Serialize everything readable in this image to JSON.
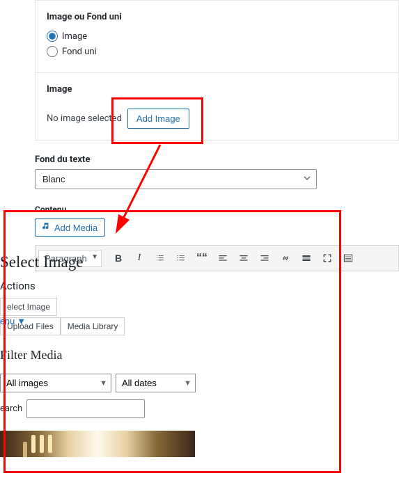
{
  "section_image_or_bg": {
    "title": "Image ou Fond uni",
    "options": {
      "image": "Image",
      "fond_uni": "Fond uni"
    },
    "selected": "image"
  },
  "section_image": {
    "title": "Image",
    "no_image_text": "No image selected",
    "add_image_label": "Add Image"
  },
  "fond_texte": {
    "label": "Fond du texte",
    "selected": "Blanc"
  },
  "contenu": {
    "label": "Contenu",
    "add_media_label": "Add Media",
    "format_selector": "Paragraph"
  },
  "modal": {
    "title": "Select Image",
    "actions_label": "Actions",
    "menu_label": "enu",
    "tabs": {
      "select_image": "elect Image",
      "upload_files": "Upload Files",
      "media_library": "Media Library"
    },
    "filter_header": "Filter Media",
    "filter_type": "All images",
    "filter_date": "All dates",
    "search_label": "earch",
    "search_value": ""
  }
}
